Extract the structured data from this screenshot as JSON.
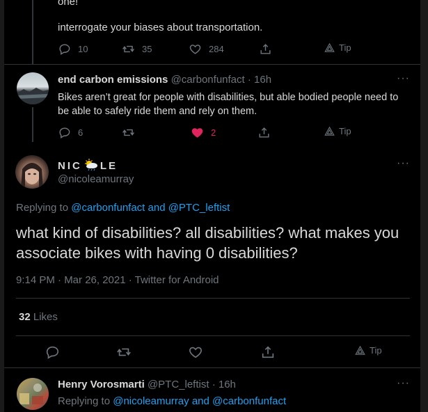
{
  "tweet1": {
    "partial_text": "one!",
    "text": "interrogate your biases about transportation.",
    "replies": "10",
    "retweets": "35",
    "likes": "284",
    "tip": "Tip"
  },
  "tweet2": {
    "name": "end carbon emissions",
    "handle": "@carbonfunfact",
    "time": "· 16h",
    "text": "Bikes aren’t great for people with disabilities, but able bodied people need to be able to safely ride them and rely on them.",
    "replies": "6",
    "likes": "2",
    "tip": "Tip",
    "like_color": "#e0245e"
  },
  "main": {
    "name_left": "NIC",
    "name_right": "LE",
    "handle": "@nicoleamurray",
    "replying_prefix": "Replying to ",
    "replying_to": "@carbonfunfact and @PTC_leftist",
    "text": "what kind of disabilities? all disabilities? what makes you associate bikes with having 0 disabilities?",
    "meta": "9:14 PM · Mar 26, 2021 · Twitter for Android",
    "likes_count": "32",
    "likes_label": " Likes",
    "tip": "Tip"
  },
  "reply": {
    "name": "Henry Vorosmarti",
    "handle": "@PTC_leftist",
    "time": "· 16h",
    "replying_prefix": "Replying to ",
    "replying_to": "@nicoleamurray and @carbonfunfact"
  },
  "more_label": "···",
  "colors": {
    "background": "#000000",
    "accent": "#1da1f2",
    "like": "#e0245e"
  }
}
